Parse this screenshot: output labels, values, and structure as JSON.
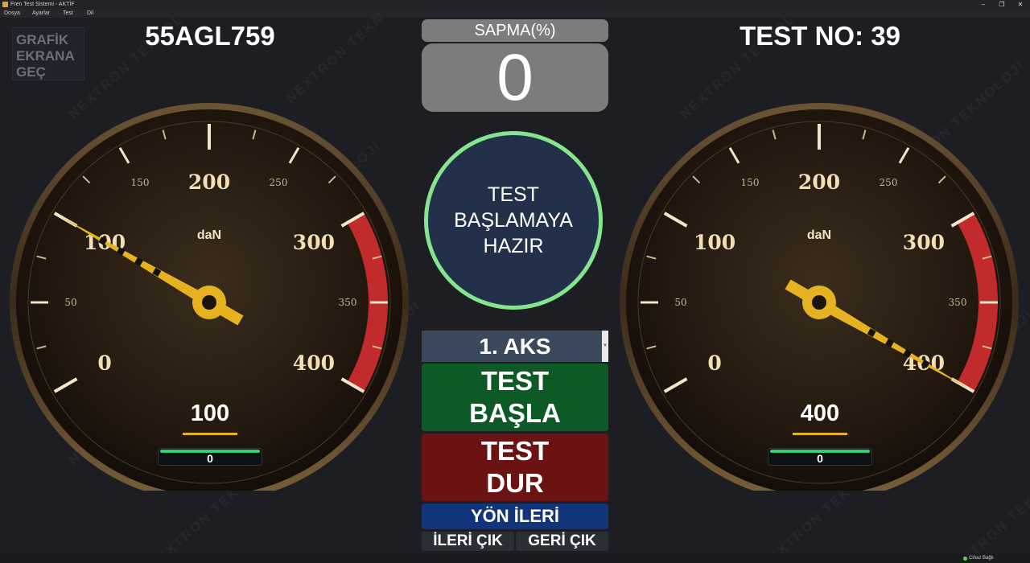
{
  "window": {
    "title": "Fren Test Sistemi - AKTİF",
    "minimize_icon": "minimize-icon",
    "maximize_icon": "restore-icon",
    "close_icon": "close-icon"
  },
  "menu": [
    "Dosya",
    "Ayarlar",
    "Test",
    "Dil"
  ],
  "header": {
    "grafik_button": "GRAFİK\nEKRANA\nGEÇ",
    "plate": "55AGL759",
    "test_no": "TEST NO: 39"
  },
  "sapma": {
    "label": "SAPMA(%)",
    "value": "0"
  },
  "status": {
    "text": "TEST\nBAŞLAMAYA\nHAZIR",
    "border_color": "#86e38e"
  },
  "controls": {
    "aks_selected": "1. AKS",
    "start_label": "TEST\nBAŞLA",
    "stop_label": "TEST\nDUR",
    "yon_label": "YÖN İLERİ",
    "ileri_cik": "İLERİ ÇIK",
    "geri_cik": "GERİ ÇIK"
  },
  "gauges": {
    "unit": "daN",
    "min": 0,
    "max": 400,
    "red_from": 300,
    "major_ticks": [
      "0",
      "100",
      "200",
      "300",
      "400"
    ],
    "minor_ticks": [
      "50",
      "150",
      "250",
      "350"
    ],
    "left": {
      "value": 100,
      "display": "100",
      "sub_value": "0"
    },
    "right": {
      "value": 400,
      "display": "400",
      "sub_value": "0"
    }
  },
  "statusbar": {
    "text": "Cihaz Bağlı",
    "color": "#4cd964"
  },
  "watermark": "NEXTRON TEKNOLOJİ",
  "colors": {
    "red_zone": "#c22b2b",
    "needle": "#e6b21f",
    "label_gold": "#f2dfb5",
    "start_green": "#0e5a26",
    "stop_red": "#6b1313",
    "yon_blue": "#12347a"
  }
}
